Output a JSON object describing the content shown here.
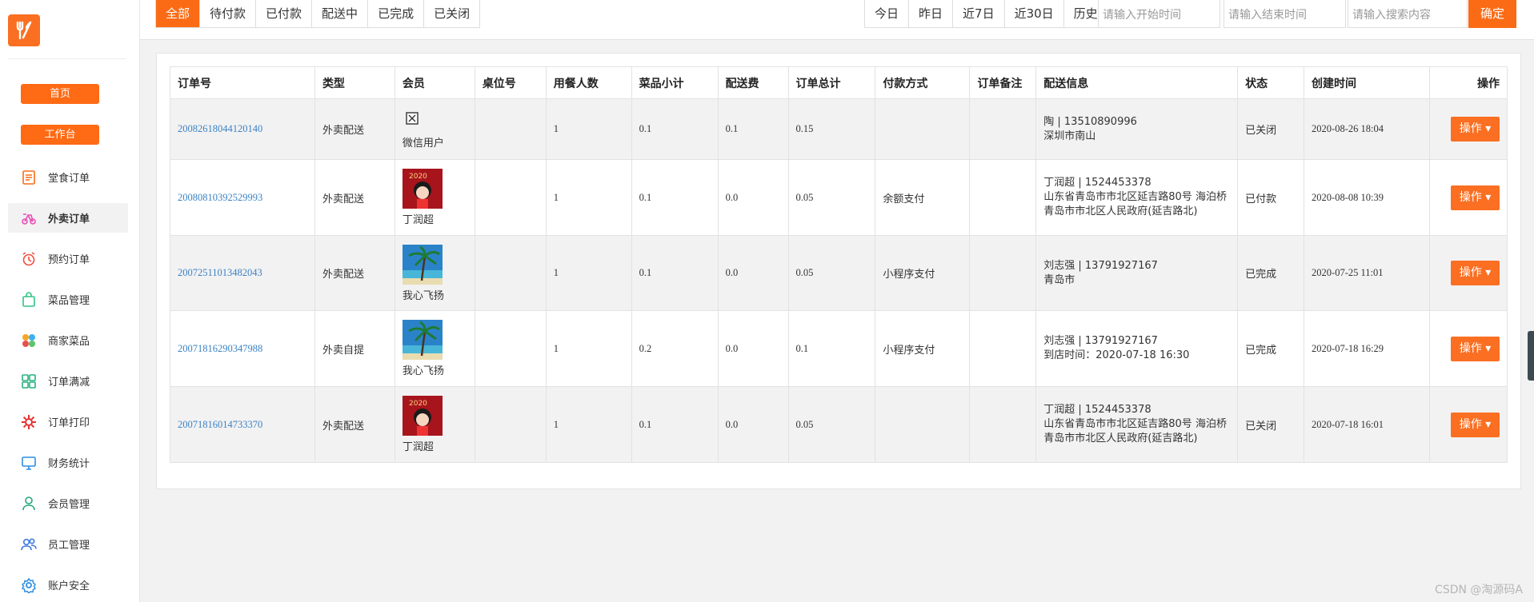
{
  "sidebar": {
    "home_label": "首页",
    "workbench_label": "工作台",
    "items": [
      {
        "label": "堂食订单",
        "icon": "order-list-icon",
        "color": "#fb6b16"
      },
      {
        "label": "外卖订单",
        "icon": "delivery-bike-icon",
        "color": "#e94fb8",
        "active": true
      },
      {
        "label": "预约订单",
        "icon": "alarm-clock-icon",
        "color": "#f24b3f"
      },
      {
        "label": "菜品管理",
        "icon": "bag-icon",
        "color": "#2ec486"
      },
      {
        "label": "商家菜品",
        "icon": "color-petals-icon",
        "color": "#f5a623"
      },
      {
        "label": "订单满减",
        "icon": "grid-icon",
        "color": "#26b27e"
      },
      {
        "label": "订单打印",
        "icon": "gear-icon",
        "color": "#e52d2d"
      },
      {
        "label": "财务统计",
        "icon": "monitor-icon",
        "color": "#2d8de0"
      },
      {
        "label": "会员管理",
        "icon": "user-icon",
        "color": "#22a87a"
      },
      {
        "label": "员工管理",
        "icon": "users-icon",
        "color": "#3c7be0"
      },
      {
        "label": "账户安全",
        "icon": "settings-icon",
        "color": "#2d8de0"
      }
    ]
  },
  "toolbar": {
    "tabs": [
      "全部",
      "待付款",
      "已付款",
      "配送中",
      "已完成",
      "已关闭"
    ],
    "ranges": [
      "今日",
      "昨日",
      "近7日",
      "近30日",
      "历史"
    ],
    "start_placeholder": "请输入开始时间",
    "end_placeholder": "请输入结束时间",
    "search_placeholder": "请输入搜索内容",
    "confirm_label": "确定"
  },
  "table": {
    "headers": [
      "订单号",
      "类型",
      "会员",
      "桌位号",
      "用餐人数",
      "菜品小计",
      "配送费",
      "订单总计",
      "付款方式",
      "订单备注",
      "配送信息",
      "状态",
      "创建时间",
      "操作"
    ],
    "rows": [
      {
        "order_no": "20082618044120140",
        "type": "外卖配送",
        "member": "微信用户",
        "avatar": "broken",
        "seat": "",
        "diners": "1",
        "subtotal": "0.1",
        "delivery_fee": "0.1",
        "total": "0.15",
        "payment": "",
        "remark": "",
        "delivery_contact": "陶 | 13510890996",
        "delivery_addr": "深圳市南山",
        "status": "已关闭",
        "created": "2020-08-26 18:04",
        "op": "操作"
      },
      {
        "order_no": "20080810392529993",
        "type": "外卖配送",
        "member": "丁润超",
        "avatar": "red",
        "seat": "",
        "diners": "1",
        "subtotal": "0.1",
        "delivery_fee": "0.0",
        "total": "0.05",
        "payment": "余额支付",
        "remark": "",
        "delivery_contact": "丁润超 | 1524453378",
        "delivery_addr": "山东省青岛市市北区延吉路80号 海泊桥青岛市市北区人民政府(延吉路北)",
        "status": "已付款",
        "created": "2020-08-08 10:39",
        "op": "操作"
      },
      {
        "order_no": "20072511013482043",
        "type": "外卖配送",
        "member": "我心飞扬",
        "avatar": "beach",
        "seat": "",
        "diners": "1",
        "subtotal": "0.1",
        "delivery_fee": "0.0",
        "total": "0.05",
        "payment": "小程序支付",
        "remark": "",
        "delivery_contact": "刘志强 | 13791927167",
        "delivery_addr": "青岛市",
        "status": "已完成",
        "created": "2020-07-25 11:01",
        "op": "操作"
      },
      {
        "order_no": "20071816290347988",
        "type": "外卖自提",
        "member": "我心飞扬",
        "avatar": "beach",
        "seat": "",
        "diners": "1",
        "subtotal": "0.2",
        "delivery_fee": "0.0",
        "total": "0.1",
        "payment": "小程序支付",
        "remark": "",
        "delivery_contact": "刘志强 | 13791927167",
        "delivery_addr": "到店时间：2020-07-18 16:30",
        "status": "已完成",
        "created": "2020-07-18 16:29",
        "op": "操作"
      },
      {
        "order_no": "20071816014733370",
        "type": "外卖配送",
        "member": "丁润超",
        "avatar": "red",
        "seat": "",
        "diners": "1",
        "subtotal": "0.1",
        "delivery_fee": "0.0",
        "total": "0.05",
        "payment": "",
        "remark": "",
        "delivery_contact": "丁润超 | 1524453378",
        "delivery_addr": "山东省青岛市市北区延吉路80号 海泊桥青岛市市北区人民政府(延吉路北)",
        "status": "已关闭",
        "created": "2020-07-18 16:01",
        "op": "操作"
      }
    ]
  },
  "watermark": "CSDN @淘源码A"
}
